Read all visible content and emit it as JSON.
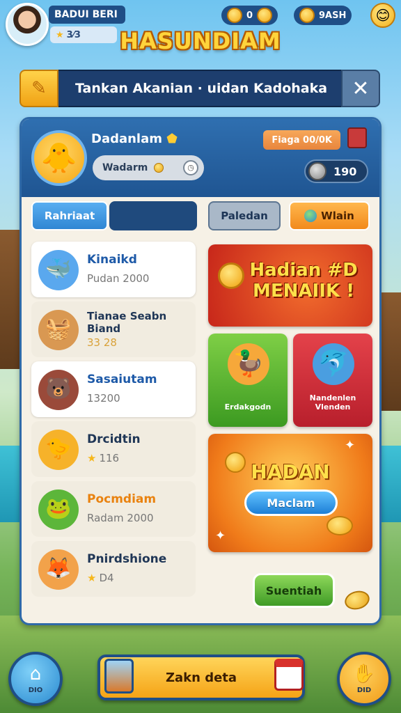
{
  "header": {
    "player_name": "BADUI BERI",
    "player_stats": "3⁄3",
    "currency_left": "0",
    "currency_right": "9ASH",
    "emoji": "😊",
    "game_title": "HASUNDIAM"
  },
  "search": {
    "text": "Tankan Akanian · uidan Kadohaka",
    "close_label": "✕"
  },
  "profile": {
    "name": "Dadanlam",
    "sub_label": "Wadarm",
    "score_label": "Fiaga 00/0K",
    "score_value": "190"
  },
  "tabs": [
    {
      "label": "Rahriaat"
    },
    {
      "label": ""
    },
    {
      "label": "Paledan"
    },
    {
      "label": "Wlain"
    }
  ],
  "list": [
    {
      "title": "Kinaikd",
      "sub": "Pudan 2000"
    },
    {
      "title": "Tianae Seabn Biand",
      "sub": "33 28"
    },
    {
      "title": "Sasaiutam",
      "sub": "13200"
    },
    {
      "title": "Drcidtin",
      "sub": "116"
    },
    {
      "title": "Pocmdiam",
      "sub": "Radam 2000"
    },
    {
      "title": "Pnirdshione",
      "sub": "D4"
    }
  ],
  "cards": {
    "promo": "Hadian #D MENAIIK !",
    "green_label": "Erdakgodn",
    "red_label": "Nandenlen Vlenden",
    "big_title": "HADAN",
    "big_button": "Maclam"
  },
  "actions": {
    "green_button": "Suentiah",
    "main_action": "Zakn deta",
    "left_label": "DIO",
    "right_label": "DID"
  },
  "colors": {
    "primary_blue": "#1f4e86",
    "accent_orange": "#f5a316",
    "title_gold": "#ffd43b",
    "promo_red": "#c7261a",
    "card_green": "#3c9a21"
  },
  "icons": {
    "search": "pencil-icon",
    "close": "close-icon",
    "home": "home-icon",
    "hand": "hand-icon"
  }
}
